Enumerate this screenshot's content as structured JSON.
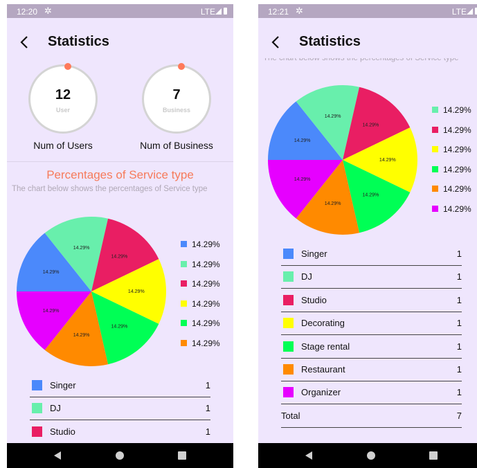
{
  "left": {
    "status": {
      "time": "12:20",
      "network": "LTE"
    },
    "title": "Statistics",
    "stats": [
      {
        "value": "12",
        "sublabel": "User",
        "caption": "Num of Users"
      },
      {
        "value": "7",
        "sublabel": "Business",
        "caption": "Num of Business"
      }
    ],
    "section_title": "Percentages of Service type",
    "section_desc": "The chart below shows the percentages of Service type",
    "legend": [
      "14.29%",
      "14.29%",
      "14.29%",
      "14.29%",
      "14.29%",
      "14.29%"
    ],
    "rows": [
      {
        "name": "Singer",
        "count": "1"
      },
      {
        "name": "DJ",
        "count": "1"
      },
      {
        "name": "Studio",
        "count": "1"
      }
    ]
  },
  "right": {
    "status": {
      "time": "12:21",
      "network": "LTE"
    },
    "title": "Statistics",
    "section_desc": "The chart below shows the percentages of Service type",
    "legend": [
      "14.29%",
      "14.29%",
      "14.29%",
      "14.29%",
      "14.29%",
      "14.29%"
    ],
    "rows": [
      {
        "name": "Singer",
        "count": "1"
      },
      {
        "name": "DJ",
        "count": "1"
      },
      {
        "name": "Studio",
        "count": "1"
      },
      {
        "name": "Decorating",
        "count": "1"
      },
      {
        "name": "Stage rental",
        "count": "1"
      },
      {
        "name": "Restaurant",
        "count": "1"
      },
      {
        "name": "Organizer",
        "count": "1"
      }
    ],
    "total": {
      "name": "Total",
      "count": "7"
    }
  },
  "chart_data": {
    "type": "pie",
    "categories": [
      "Singer",
      "DJ",
      "Studio",
      "Decorating",
      "Stage rental",
      "Restaurant",
      "Organizer"
    ],
    "values": [
      14.29,
      14.29,
      14.29,
      14.29,
      14.29,
      14.29,
      14.29
    ],
    "labels": [
      "14.29%",
      "14.29%",
      "14.29%",
      "14.29%",
      "14.29%",
      "14.29%",
      "14.29%"
    ],
    "colors": [
      "#4b89fb",
      "#68efac",
      "#e91e63",
      "#ffff00",
      "#00ff55",
      "#ff8a00",
      "#e600ff"
    ]
  },
  "icons": {
    "back": "arrow-back-icon",
    "settings": "gear-icon",
    "signal": "signal-icon",
    "battery": "battery-icon"
  }
}
